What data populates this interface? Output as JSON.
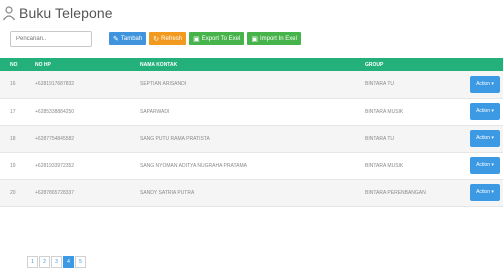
{
  "header": {
    "title": "Buku Telepone"
  },
  "toolbar": {
    "search_placeholder": "Pencarian..",
    "buttons": [
      {
        "label": "Tambah",
        "icon": "✎"
      },
      {
        "label": "Refresh",
        "icon": "↻"
      },
      {
        "label": "Export To Exel",
        "icon": "▣"
      },
      {
        "label": "Import In Exel",
        "icon": "▣"
      }
    ]
  },
  "table": {
    "columns": [
      "NO",
      "NO HP",
      "NAMA KONTAK",
      "GROUP"
    ],
    "action_label": "Action ▾",
    "rows": [
      {
        "no": "16",
        "hp": "+6281917687832",
        "nama": "SEPTIAN ARISANDI",
        "group": "BINTARA TU"
      },
      {
        "no": "17",
        "hp": "+6285338884250",
        "nama": "SAPARWADI",
        "group": "BINTARA MUSIK"
      },
      {
        "no": "18",
        "hp": "+6287754845582",
        "nama": "SANG PUTU RAMA PRATISTA",
        "group": "BINTARA TU"
      },
      {
        "no": "19",
        "hp": "+6281933972352",
        "nama": "SANG NYOMAN ADITYA NUGRAHA PRATAMA",
        "group": "BINTARA MUSIK"
      },
      {
        "no": "20",
        "hp": "+6287865728337",
        "nama": "SANDY SATRIA PUTRA",
        "group": "BINTARA PERENBANGAN"
      }
    ]
  },
  "pagination": {
    "pages": [
      "1",
      "2",
      "3",
      "4",
      "5"
    ],
    "active": "4"
  },
  "colors": {
    "header_green": "#23b07a",
    "primary_blue": "#3c99e4",
    "refresh_orange": "#f29a1f",
    "excel_green": "#46b34b"
  }
}
